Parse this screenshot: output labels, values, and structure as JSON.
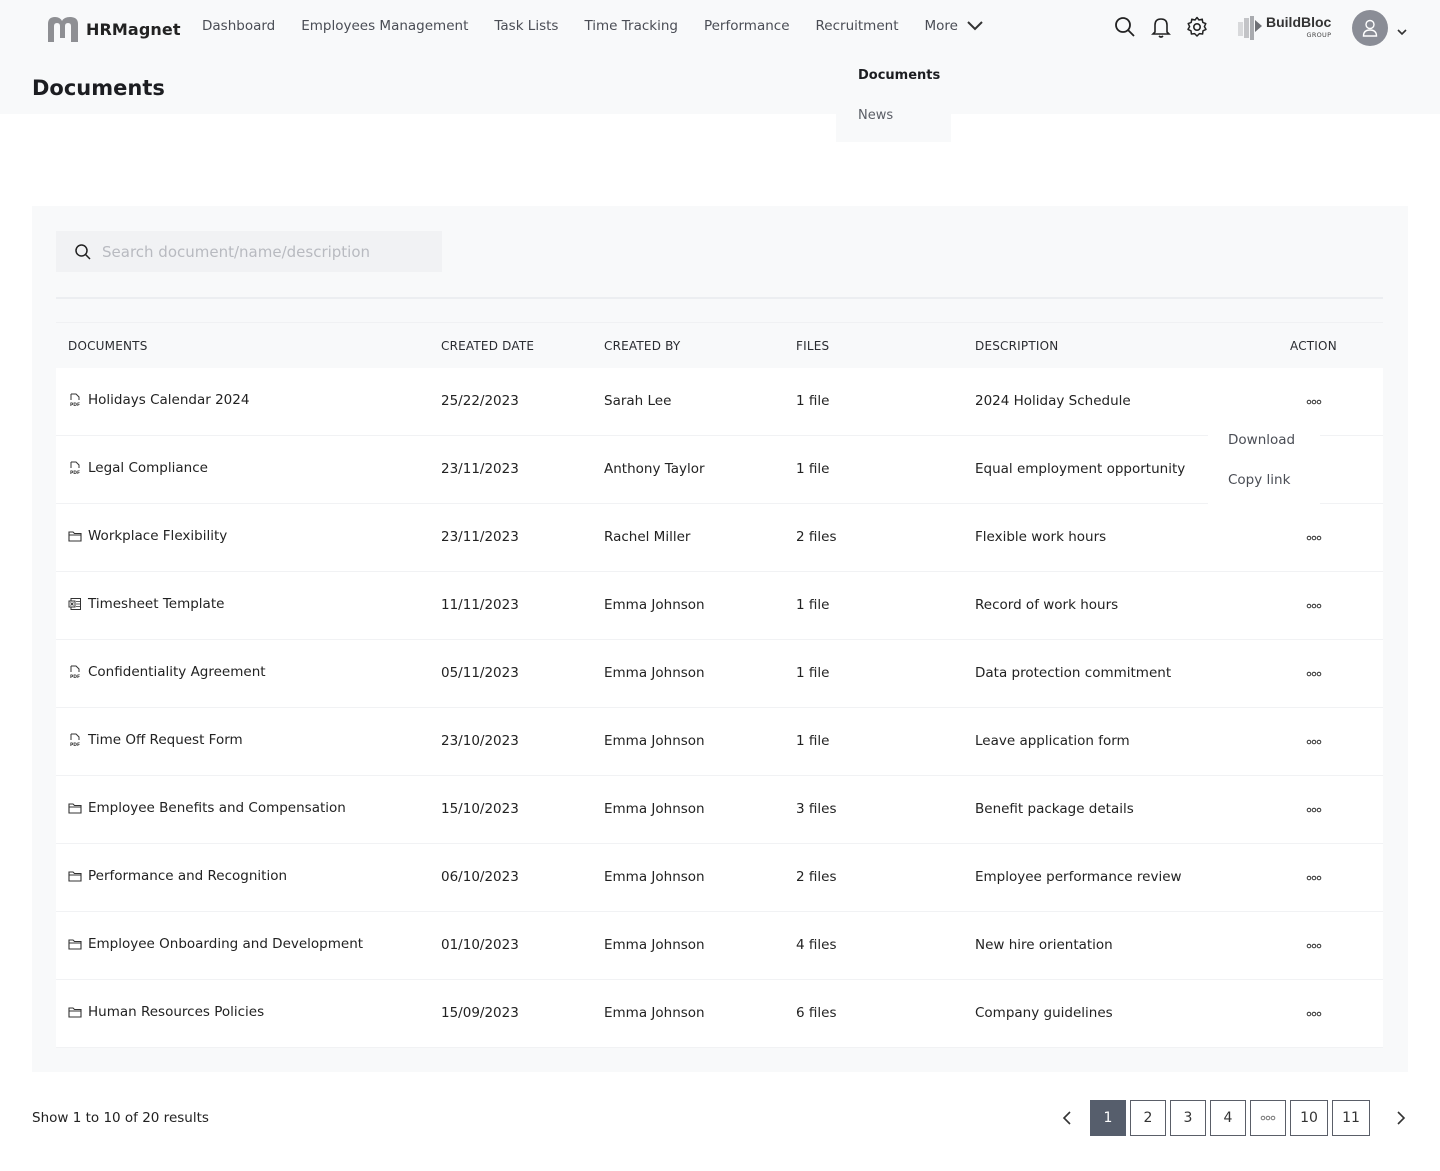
{
  "app": {
    "name": "HRMagnet"
  },
  "nav": {
    "items": [
      "Dashboard",
      "Employees Management",
      "Task Lists",
      "Time Tracking",
      "Performance",
      "Recruitment"
    ],
    "more_label": "More",
    "more_menu": [
      "Documents",
      "News"
    ]
  },
  "brand": {
    "name": "BuildBloc",
    "sub": "GROUP"
  },
  "icons": {
    "search": "search-icon",
    "notifications": "bell-icon",
    "settings": "gear-icon",
    "profile": "user-icon"
  },
  "page": {
    "title": "Documents"
  },
  "search": {
    "placeholder": "Search document/name/description",
    "value": ""
  },
  "table": {
    "headers": [
      "DOCUMENTS",
      "CREATED DATE",
      "CREATED BY",
      "FILES",
      "DESCRIPTION",
      "ACTION"
    ],
    "rows": [
      {
        "icon": "pdf",
        "name": "Holidays Calendar 2024",
        "date": "25/22/2023",
        "by": "Sarah Lee",
        "files": "1 file",
        "desc": "2024 Holiday Schedule"
      },
      {
        "icon": "pdf",
        "name": "Legal Compliance",
        "date": "23/11/2023",
        "by": "Anthony Taylor",
        "files": "1 file",
        "desc": "Equal employment opportunity"
      },
      {
        "icon": "folder",
        "name": "Workplace Flexibility",
        "date": "23/11/2023",
        "by": "Rachel Miller",
        "files": "2 files",
        "desc": "Flexible work hours"
      },
      {
        "icon": "excel",
        "name": "Timesheet Template",
        "date": "11/11/2023",
        "by": "Emma Johnson",
        "files": "1 file",
        "desc": "Record of work hours"
      },
      {
        "icon": "pdf",
        "name": "Confidentiality Agreement",
        "date": "05/11/2023",
        "by": "Emma Johnson",
        "files": "1 file",
        "desc": "Data protection commitment"
      },
      {
        "icon": "pdf",
        "name": "Time Off Request Form",
        "date": "23/10/2023",
        "by": "Emma Johnson",
        "files": "1 file",
        "desc": "Leave application form"
      },
      {
        "icon": "folder",
        "name": "Employee Benefits and Compensation",
        "date": "15/10/2023",
        "by": "Emma Johnson",
        "files": "3 files",
        "desc": "Benefit package details"
      },
      {
        "icon": "folder",
        "name": "Performance and Recognition",
        "date": "06/10/2023",
        "by": "Emma Johnson",
        "files": "2 files",
        "desc": "Employee performance review"
      },
      {
        "icon": "folder",
        "name": "Employee Onboarding and Development",
        "date": "01/10/2023",
        "by": "Emma Johnson",
        "files": "4 files",
        "desc": "New hire orientation"
      },
      {
        "icon": "folder",
        "name": "Human Resources Policies",
        "date": "15/09/2023",
        "by": "Emma Johnson",
        "files": "6 files",
        "desc": "Company guidelines"
      }
    ]
  },
  "row_menu": {
    "items": [
      "Download",
      "Copy link"
    ]
  },
  "footer": {
    "results_text": "Show 1 to 10 of 20 results",
    "pages": [
      "1",
      "2",
      "3",
      "4",
      "...",
      "10",
      "11"
    ],
    "current_page": "1"
  },
  "colors": {
    "active_page": "#565e6c",
    "avatar": "#8a8d96"
  }
}
